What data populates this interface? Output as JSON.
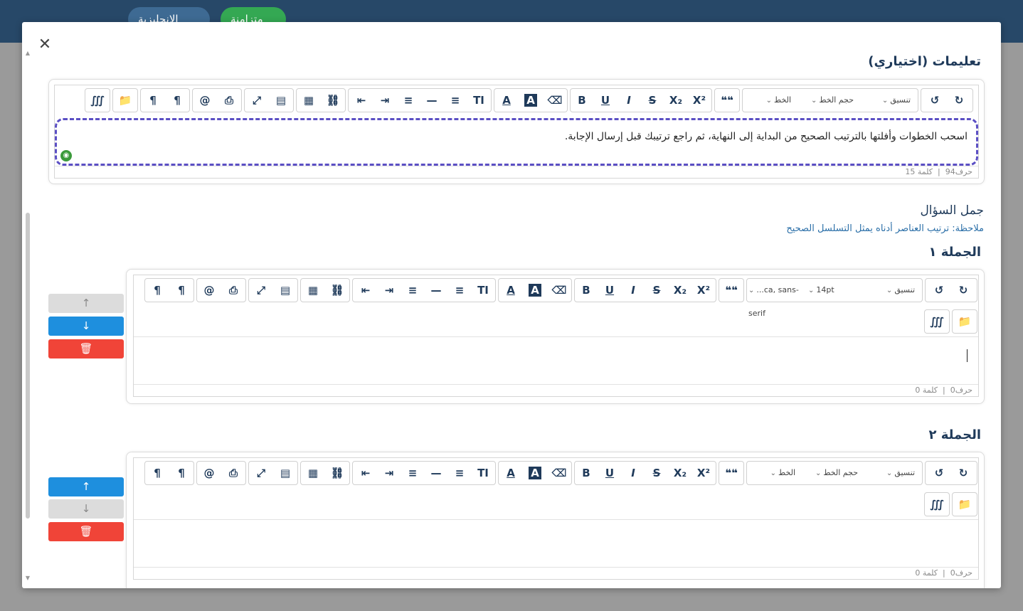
{
  "topbar": {
    "lang_label": "الإنجليزية",
    "sync_label": "متزامنة"
  },
  "modal": {
    "close_glyph": "✕",
    "instructions_title": "تعليمات (اختياري)",
    "sentences_title": "جمل السؤال",
    "note": "ملاحظة: ترتيب العناصر أدناه يمثل التسلسل الصحيح",
    "sentence1_label": "الجملة ١",
    "sentence2_label": "الجملة ٢"
  },
  "toolbar": {
    "format_label": "تنسيق",
    "size_label": "حجم الخط",
    "font_label": "الخط",
    "font_value_1": "...ca, sans-serif",
    "size_value_1": "14pt",
    "buttons": {
      "undo": "↺",
      "redo": "↻",
      "blockquote": "❝❝",
      "superscript": "X²",
      "subscript": "X₂",
      "strike": "S",
      "italic": "I",
      "underline": "U",
      "bold": "B",
      "eraser": "⌫",
      "bgcolor": "A",
      "forecolor": "A",
      "textsize": "TI",
      "olist": "≡",
      "hr": "—",
      "align": "≡",
      "indent": "⇥",
      "outdent": "⇤",
      "link": "⛓",
      "table": "▦",
      "template": "▤",
      "fullscreen": "⤢",
      "print": "⎙",
      "mention": "@",
      "ltr": "¶",
      "rtl": "¶",
      "folder": "📁",
      "special": "∭"
    }
  },
  "editors": {
    "instructions": {
      "text": "اسحب الخطوات وأفلتها بالترتيب الصحيح من البداية إلى النهاية، ثم راجع ترتيبك قبل إرسال الإجابة.",
      "chars": "حرف94",
      "words": "كلمة 15"
    },
    "sentence1": {
      "text": "",
      "chars": "حرف0",
      "words": "كلمة 0"
    },
    "sentence2": {
      "text": "",
      "chars": "حرف0",
      "words": "كلمة 0"
    }
  },
  "side_buttons": {
    "up": "↑",
    "down": "↓",
    "delete": "🗑"
  },
  "colors": {
    "accent": "#1e8fde",
    "danger": "#f04438",
    "highlight": "#5b4fc4",
    "title": "#1f3a5a"
  }
}
